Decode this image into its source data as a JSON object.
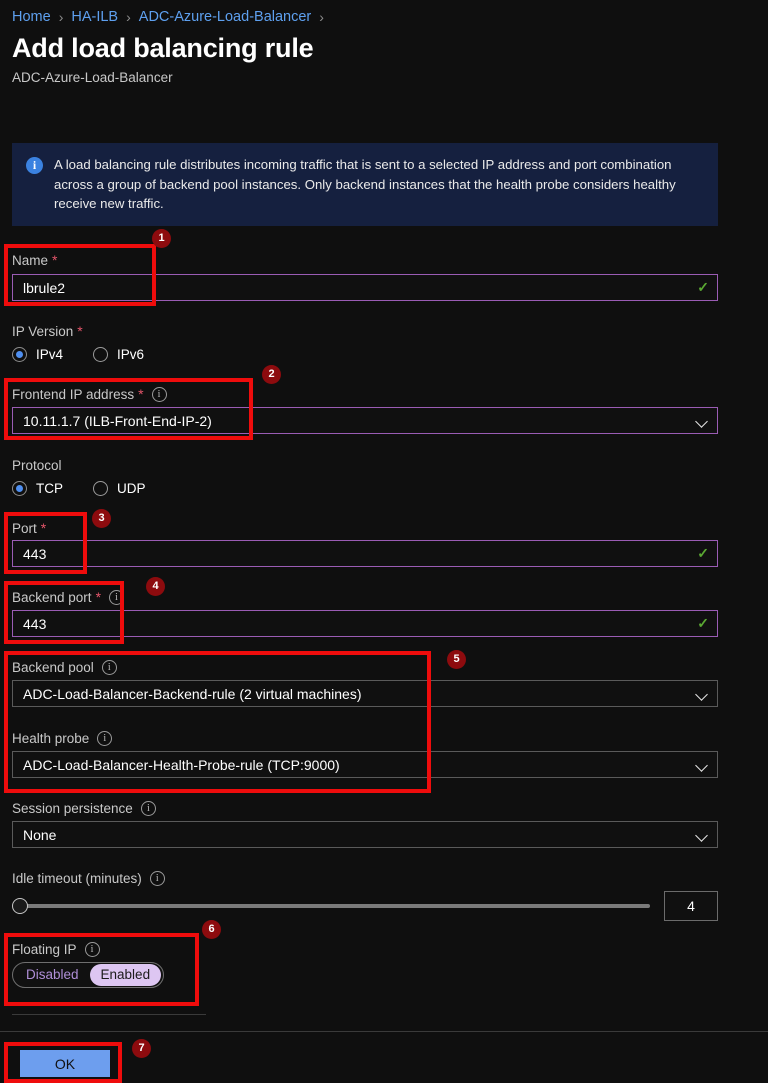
{
  "breadcrumb": {
    "items": [
      "Home",
      "HA-ILB",
      "ADC-Azure-Load-Balancer"
    ],
    "separator": "›"
  },
  "header": {
    "title": "Add load balancing rule",
    "subtitle": "ADC-Azure-Load-Balancer"
  },
  "info_banner": {
    "icon": "info-icon",
    "text": "A load balancing rule distributes incoming traffic that is sent to a selected IP address and port combination across a group of backend pool instances. Only backend instances that the health probe considers healthy receive new traffic."
  },
  "form": {
    "name": {
      "label": "Name",
      "required_marker": "*",
      "value": "lbrule2",
      "valid_mark": "✓"
    },
    "ip_version": {
      "label": "IP Version",
      "required_marker": "*",
      "options": [
        "IPv4",
        "IPv6"
      ],
      "selected": "IPv4"
    },
    "frontend_ip": {
      "label": "Frontend IP address",
      "required_marker": "*",
      "info": "ⓘ",
      "value": "10.11.1.7 (ILB-Front-End-IP-2)"
    },
    "protocol": {
      "label": "Protocol",
      "options": [
        "TCP",
        "UDP"
      ],
      "selected": "TCP"
    },
    "port": {
      "label": "Port",
      "required_marker": "*",
      "value": "443",
      "valid_mark": "✓"
    },
    "backend_port": {
      "label": "Backend port",
      "required_marker": "*",
      "info": "ⓘ",
      "value": "443",
      "valid_mark": "✓"
    },
    "backend_pool": {
      "label": "Backend pool",
      "info": "ⓘ",
      "value": "ADC-Load-Balancer-Backend-rule (2 virtual machines)"
    },
    "health_probe": {
      "label": "Health probe",
      "info": "ⓘ",
      "value": "ADC-Load-Balancer-Health-Probe-rule (TCP:9000)"
    },
    "session_persistence": {
      "label": "Session persistence",
      "info": "ⓘ",
      "value": "None"
    },
    "idle_timeout": {
      "label": "Idle timeout (minutes)",
      "info": "ⓘ",
      "value": "4",
      "min": "4",
      "max": "30",
      "slider_percent": 0
    },
    "floating_ip": {
      "label": "Floating IP",
      "info": "ⓘ",
      "options": [
        "Disabled",
        "Enabled"
      ],
      "selected": "Enabled"
    }
  },
  "footer": {
    "ok_label": "OK"
  },
  "annotations": {
    "badges": [
      "1",
      "2",
      "3",
      "4",
      "5",
      "6",
      "7"
    ],
    "color": "#ef0c0c"
  },
  "colors": {
    "accent_link": "#5ea0ef",
    "focus_border": "#9a5cb4",
    "valid_green": "#5aa832",
    "required_red": "#e4556a",
    "banner_bg": "#15203f",
    "ok_button": "#6d9eee",
    "toggle_active_bg": "#ddc6f2",
    "annotation_red": "#ef0c0c",
    "badge_bg": "#8d0b0e"
  }
}
